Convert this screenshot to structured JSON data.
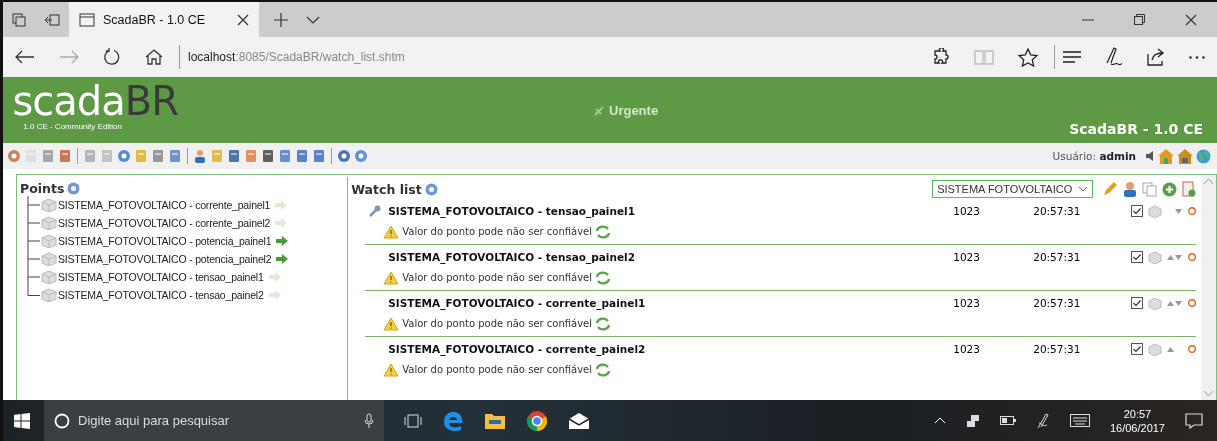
{
  "browser": {
    "tab_title": "ScadaBR - 1.0 CE",
    "address_host": "localhost",
    "address_path": ":8085/ScadaBR/watch_list.shtm"
  },
  "header": {
    "logo_main": "scada",
    "logo_accent": "BR",
    "logo_edition": "1.0 CE - Community Edition",
    "alarm_label": "Urgente",
    "product": "ScadaBR - 1.0 CE",
    "user": "Usuário: **admin**"
  },
  "points": {
    "title": "Points",
    "items": [
      {
        "label": "SISTEMA_FOTOVOLTAICO - corrente_painel1",
        "in_watch_list": true
      },
      {
        "label": "SISTEMA_FOTOVOLTAICO - corrente_painel2",
        "in_watch_list": true
      },
      {
        "label": "SISTEMA_FOTOVOLTAICO - potencia_painel1",
        "in_watch_list": false
      },
      {
        "label": "SISTEMA_FOTOVOLTAICO - potencia_painel2",
        "in_watch_list": false
      },
      {
        "label": "SISTEMA_FOTOVOLTAICO - tensao_painel1",
        "in_watch_list": true
      },
      {
        "label": "SISTEMA_FOTOVOLTAICO - tensao_painel2",
        "in_watch_list": true
      }
    ]
  },
  "watch_list": {
    "title": "Watch list",
    "selected_list": "SISTEMA FOTOVOLTAICO",
    "rows": [
      {
        "name": "SISTEMA_FOTOVOLTAICO - tensao_painel1",
        "value": "1023",
        "time": "20:57:31",
        "warning": "Valor do ponto pode não ser confiável",
        "settable": true,
        "checked": true,
        "can_move_up": false,
        "can_move_down": true
      },
      {
        "name": "SISTEMA_FOTOVOLTAICO - tensao_painel2",
        "value": "1023",
        "time": "20:57:31",
        "warning": "Valor do ponto pode não ser confiável",
        "settable": false,
        "checked": true,
        "can_move_up": true,
        "can_move_down": true
      },
      {
        "name": "SISTEMA_FOTOVOLTAICO - corrente_painel1",
        "value": "1023",
        "time": "20:57:31",
        "warning": "Valor do ponto pode não ser confiável",
        "settable": false,
        "checked": true,
        "can_move_up": true,
        "can_move_down": true
      },
      {
        "name": "SISTEMA_FOTOVOLTAICO - corrente_painel2",
        "value": "1023",
        "time": "20:57:31",
        "warning": "Valor do ponto pode não ser confiável",
        "settable": false,
        "checked": true,
        "can_move_up": true,
        "can_move_down": false
      }
    ]
  },
  "taskbar": {
    "search_placeholder": "Digite aqui para pesquisar",
    "time": "20:57",
    "date": "16/06/2017"
  }
}
